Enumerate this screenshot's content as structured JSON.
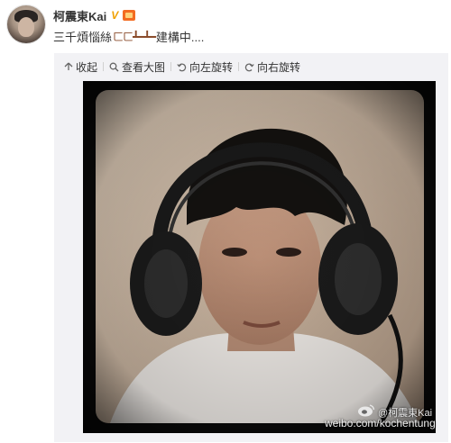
{
  "post": {
    "username": "柯震東Kai",
    "verified_badge": "V",
    "text_prefix": "三千煩惱絲",
    "emoticon": "ㄈㄈ┻━┻━",
    "text_suffix": "建構中....",
    "avatar_icon": "user-avatar"
  },
  "toolbar": {
    "collapse_label": "收起",
    "view_large_label": "查看大图",
    "rotate_left_label": "向左旋转",
    "rotate_right_label": "向右旋转"
  },
  "photo": {
    "watermark_user": "@柯震東Kai",
    "watermark_url": "weibo.com/kochentung"
  },
  "colors": {
    "accent_orange": "#f0a000",
    "media_background": "#f2f2f5",
    "text": "#333333"
  }
}
